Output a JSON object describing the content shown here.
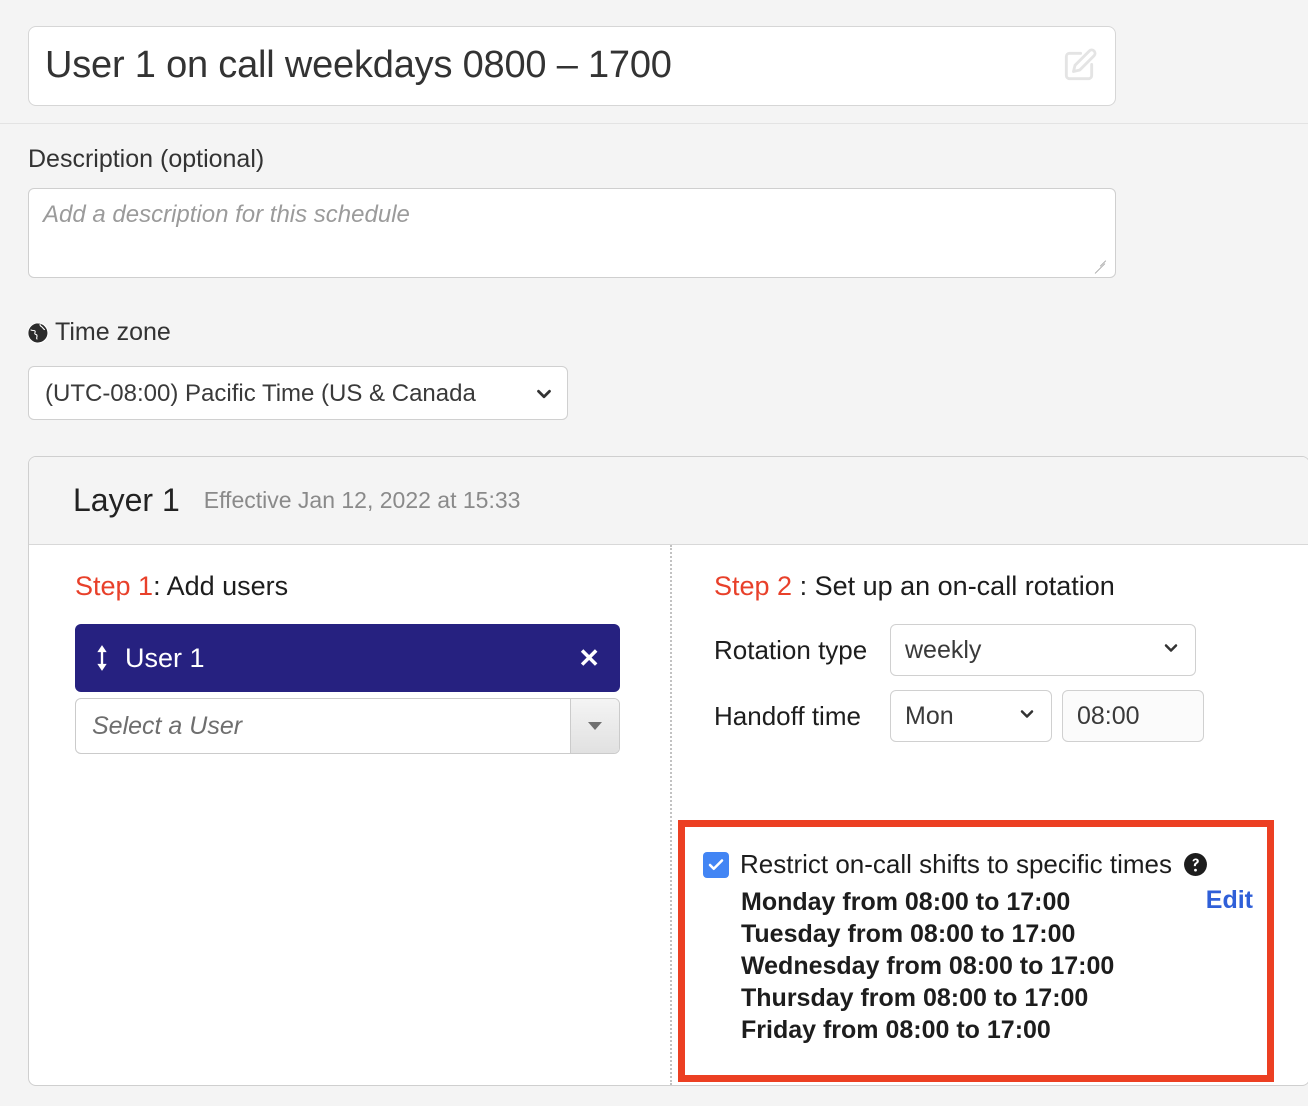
{
  "schedule": {
    "title": "User 1 on call weekdays 0800 – 1700",
    "edit_icon": "pencil-square-icon",
    "description_label": "Description (optional)",
    "description_value": "",
    "description_placeholder": "Add a description for this schedule",
    "timezone_label": "Time zone",
    "timezone_icon": "globe-icon",
    "timezone_value": "(UTC-08:00) Pacific Time (US & Canada"
  },
  "layer": {
    "title": "Layer 1",
    "effective": "Effective Jan 12, 2022 at 15:33"
  },
  "step1": {
    "number": "Step 1",
    "separator": ": Add users",
    "user_chip": {
      "drag_icon": "updown-arrow-icon",
      "name": "User 1",
      "close_icon": "✕"
    },
    "select_user_placeholder": "Select a User",
    "select_user_value": "",
    "dropdown_icon": "triangle-down-icon"
  },
  "step2": {
    "number": "Step 2",
    "separator": " : Set up an on-call rotation",
    "rotation_type_label": "Rotation type",
    "rotation_type_value": "weekly",
    "handoff_time_label": "Handoff time",
    "handoff_day_value": "Mon",
    "handoff_time_value": "08:00"
  },
  "restrict": {
    "checked": true,
    "label": "Restrict on-call shifts to specific times",
    "help_icon": "question-circle-icon",
    "edit_link": "Edit",
    "lines": [
      "Monday from 08:00 to 17:00",
      "Tuesday from 08:00 to 17:00",
      "Wednesday from 08:00 to 17:00",
      "Thursday from 08:00 to 17:00",
      "Friday from 08:00 to 17:00"
    ]
  },
  "colors": {
    "accent_red": "#ec3f22",
    "step_red": "#e8402a",
    "chip_navy": "#262180",
    "checkbox_blue": "#4285f4",
    "link_blue": "#2f5fd8",
    "page_bg": "#f4f4f4"
  }
}
